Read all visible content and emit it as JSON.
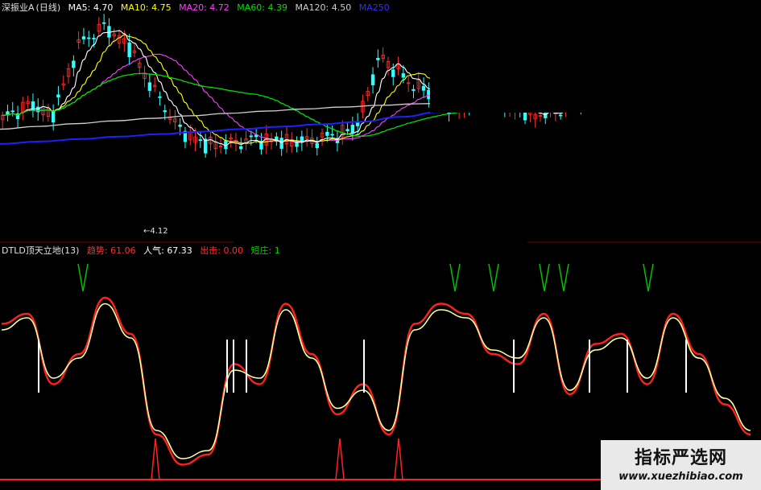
{
  "main_legend": {
    "stock": "深振业A",
    "period": "(日线)",
    "ma5_label": "MA5:",
    "ma5_value": "4.70",
    "ma10_label": "MA10:",
    "ma10_value": "4.75",
    "ma20_label": "MA20:",
    "ma20_value": "4.72",
    "ma60_label": "MA60:",
    "ma60_value": "4.39",
    "ma120_label": "MA120:",
    "ma120_value": "4.50",
    "ma250_label": "MA250"
  },
  "low_marker": "←4.12",
  "indicator_legend": {
    "name": "DTLD顶天立地(13)",
    "trend_label": "趋势:",
    "trend_value": "61.06",
    "pop_label": "人气:",
    "pop_value": "67.33",
    "exit_label": "出击:",
    "exit_value": "0.00",
    "short_label": "短庄:",
    "short_value": "1"
  },
  "watermark": {
    "title": "指标严选网",
    "url": "www.xuezhibiao.com"
  },
  "colors": {
    "ma5": "#ffffff",
    "ma10": "#ffff00",
    "ma20": "#ff40ff",
    "ma60": "#00e000",
    "ma120": "#d0d0d0",
    "ma250": "#2020ff",
    "candle_up": "#ff3030",
    "candle_down": "#30ffff",
    "trend": "#ff2020",
    "popularity": "#ffffa0",
    "top_signal": "#00c000",
    "bottom_signal": "#ff2020",
    "white_bar": "#ffffff"
  },
  "chart_data": {
    "type": "line",
    "series": [
      {
        "name": "MA250",
        "values": [
          2.2,
          2.25,
          2.3,
          2.35,
          2.4,
          2.45,
          2.5,
          2.55,
          2.6,
          2.65,
          2.75,
          2.85,
          2.95,
          3.05,
          3.15,
          3.25,
          3.35,
          3.45,
          3.55,
          3.6
        ]
      },
      {
        "name": "趋势",
        "values": [
          75,
          80,
          45,
          60,
          88,
          70,
          20,
          5,
          10,
          55,
          45,
          85,
          60,
          30,
          45,
          20,
          75,
          85,
          80,
          60,
          55,
          80,
          40,
          65,
          70,
          45,
          80,
          60,
          35,
          20
        ]
      },
      {
        "name": "人气",
        "values": [
          72,
          78,
          48,
          58,
          85,
          68,
          22,
          8,
          12,
          52,
          48,
          82,
          58,
          33,
          42,
          22,
          72,
          82,
          78,
          62,
          58,
          78,
          42,
          62,
          68,
          48,
          78,
          58,
          38,
          22
        ]
      }
    ],
    "price_low_label": "4.12",
    "indicator_range": [
      0,
      100
    ]
  }
}
